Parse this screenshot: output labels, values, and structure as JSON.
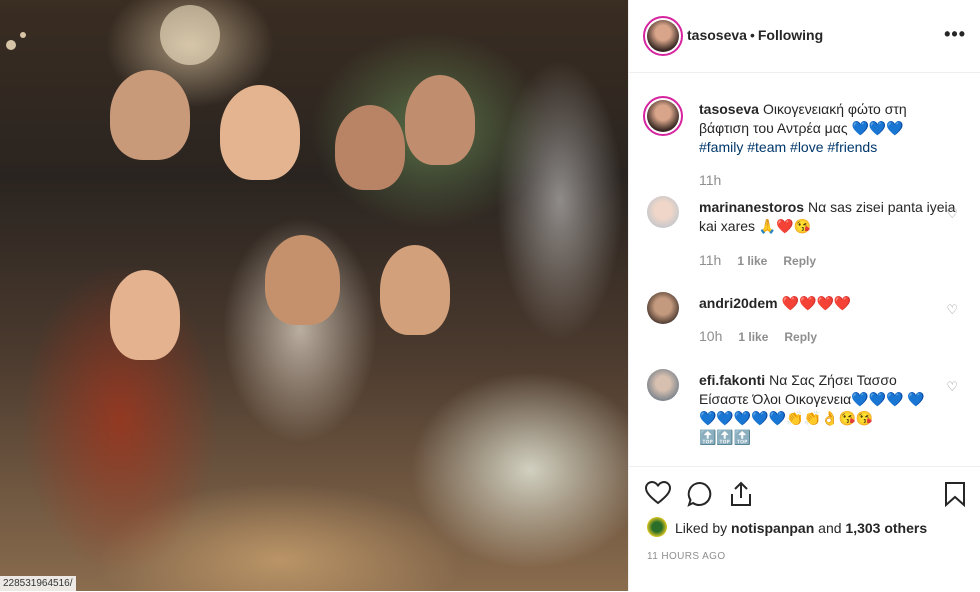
{
  "photo": {
    "url_fragment": "228531964516/"
  },
  "header": {
    "username": "tasoseva",
    "separator": "•",
    "follow_status": "Following",
    "more": "•••"
  },
  "caption": {
    "username": "tasoseva",
    "text": "Οικογενειακή φώτο στη βάφτιση του Αντρέα μας 💙💙💙",
    "hashtags": "#family #team #love #friends",
    "time": "11h"
  },
  "comments": [
    {
      "username": "marinanestoros",
      "text": "Να sas zisei panta iyeia kai xares 🙏❤️😘",
      "time": "11h",
      "likes": "1 like",
      "reply": "Reply"
    },
    {
      "username": "andri20dem",
      "text": "❤️❤️❤️❤️",
      "time": "10h",
      "likes": "1 like",
      "reply": "Reply"
    },
    {
      "username": "efi.fakonti",
      "text": "Να Σας Ζήσει Τασσο Είσαστε Όλοι Οικογενεια💙💙💙 💙💙💙💙💙💙👏👏👌😘😘 🔝🔝🔝",
      "time": "",
      "likes": "",
      "reply": ""
    }
  ],
  "actions": {
    "liked_prefix": "Liked by",
    "liked_user": "notispanpan",
    "liked_and": "and",
    "liked_count": "1,303 others",
    "timestamp": "11 HOURS AGO"
  }
}
